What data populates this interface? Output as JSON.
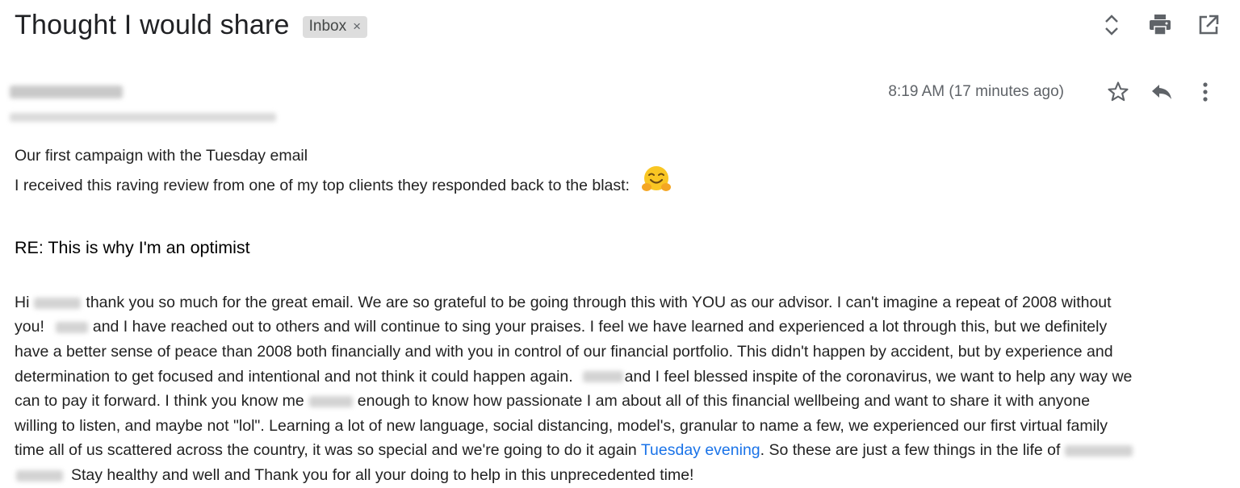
{
  "header": {
    "subject": "Thought I would share",
    "label": "Inbox",
    "label_remove": "×"
  },
  "toolbar": {
    "icons": [
      "expand-collapse-icon",
      "print-icon",
      "open-new-window-icon"
    ]
  },
  "message": {
    "time": "8:19 AM (17 minutes ago)",
    "icons": [
      "star-icon",
      "reply-icon",
      "more-vert-icon"
    ]
  },
  "body": {
    "intro_line1": "Our first campaign with the Tuesday email",
    "intro_line2": "I received this raving review from one of my top clients they responded back to the blast:",
    "re_title": "RE: This is why I'm an optimist",
    "p1_hi": "Hi",
    "p1_a": "thank you so much for the great email.  We are so grateful to be going through this with YOU as our advisor.  I can't imagine a repeat of 2008 without",
    "p2_a": "you!",
    "p2_b": "and I have reached out to others and will continue to sing your praises.  I feel we have learned and experienced a lot through this, but we definitely",
    "p3": "have a better sense of peace than 2008 both financially and with you in control of our financial portfolio. This didn't happen by accident, but by experience and",
    "p4_a": "determination to get focused and intentional and not think it could happen again.",
    "p4_b": "and I feel blessed inspite of the coronavirus, we want to help any way we",
    "p5_a": "can to pay it forward.  I think you know me",
    "p5_b": "enough to know how passionate I am about all of this financial wellbeing and want to share it with anyone",
    "p6": "willing to listen, and maybe not \"lol\".  Learning a lot of new language, social distancing, model's, granular to name a few, we experienced our first virtual family",
    "p7_a": "time all of us scattered across the country, it was so special and we're going to do it again",
    "p7_link": "Tuesday evening",
    "p7_b": ".  So these are just a  few things in the life of",
    "p8": "Stay healthy and well and Thank you for all your doing to help in this unprecedented time!"
  },
  "colors": {
    "link": "#1a73e8",
    "chip_bg": "#dddddd",
    "muted": "#5f6368"
  }
}
